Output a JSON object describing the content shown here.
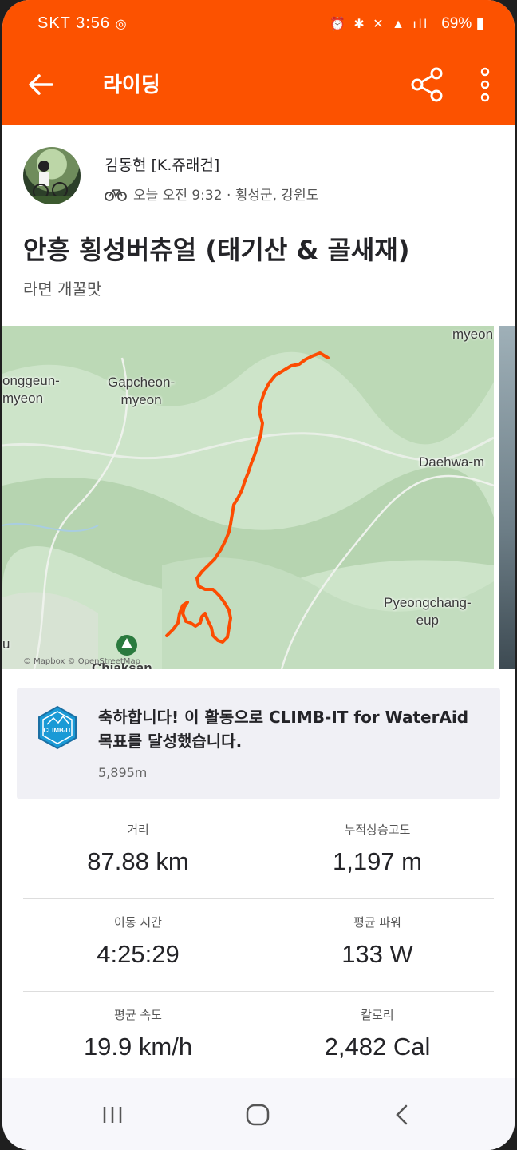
{
  "status_bar": {
    "carrier": "SKT",
    "time": "3:56",
    "notification_icons": "instagram-icon",
    "system_icons": "alarm bluetooth mute lte signal",
    "battery": "69%"
  },
  "app_bar": {
    "title": "라이딩",
    "accent_color": "#fc5200"
  },
  "activity": {
    "author": "김동현 [K.쥬래건]",
    "meta": "오늘 오전 9:32 · 횡성군, 강원도",
    "title": "안흥 횡성버츄얼 (태기산 & 골새재)",
    "description": "라면 개꿀맛"
  },
  "map": {
    "labels": {
      "l1": "myeon",
      "l2": "onggeun-\nmyeon",
      "l3": "Gapcheon-\nmyeon",
      "l4": "Daehwa-m",
      "l5": "Pyeongchang-\neup",
      "l6": "Chiaksan",
      "l7": "u"
    },
    "attribution": "© Mapbox © OpenStreetMap",
    "route_color": "#fc4c02"
  },
  "goal": {
    "text": "축하합니다! 이 활동으로 CLIMB-IT for WaterAid 목표를 달성했습니다.",
    "value": "5,895m",
    "badge_text": "CLIMB-IT"
  },
  "stats": {
    "distance": {
      "label": "거리",
      "value": "87.88 km"
    },
    "elevation": {
      "label": "누적상승고도",
      "value": "1,197 m"
    },
    "moving_time": {
      "label": "이동 시간",
      "value": "4:25:29"
    },
    "avg_power": {
      "label": "평균 파워",
      "value": "133 W"
    },
    "avg_speed": {
      "label": "평균 속도",
      "value": "19.9 km/h"
    },
    "calories": {
      "label": "칼로리",
      "value": "2,482 Cal"
    }
  }
}
